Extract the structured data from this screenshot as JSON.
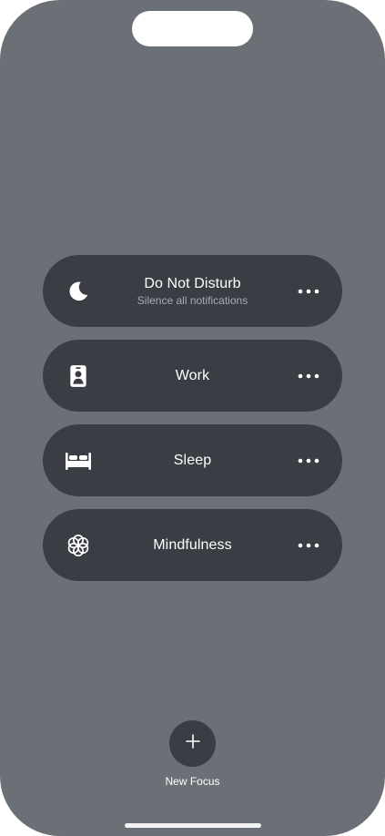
{
  "focus_modes": [
    {
      "title": "Do Not Disturb",
      "subtitle": "Silence all notifications",
      "icon": "moon-icon"
    },
    {
      "title": "Work",
      "subtitle": "",
      "icon": "id-badge-icon"
    },
    {
      "title": "Sleep",
      "subtitle": "",
      "icon": "bed-icon"
    },
    {
      "title": "Mindfulness",
      "subtitle": "",
      "icon": "flower-icon"
    }
  ],
  "more_icon": "ellipsis-icon",
  "new_focus": {
    "label": "New Focus",
    "icon": "plus-icon"
  },
  "colors": {
    "background": "#6b7077",
    "card": "#3a3e44",
    "text": "#ffffff",
    "subtext": "#a9adb3"
  }
}
